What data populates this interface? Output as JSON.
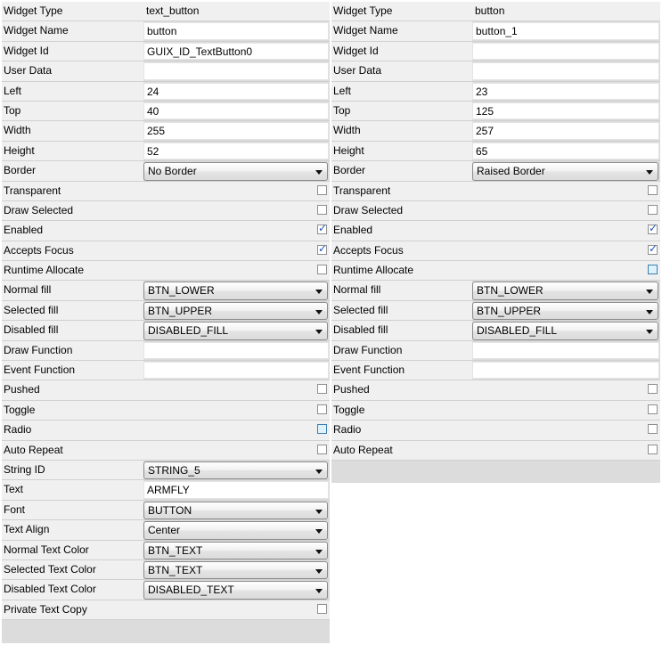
{
  "left_panel": {
    "rows": [
      {
        "label": "Widget Type",
        "kind": "readonly",
        "value": "text_button"
      },
      {
        "label": "Widget Name",
        "kind": "text",
        "value": "button"
      },
      {
        "label": "Widget Id",
        "kind": "text",
        "value": "GUIX_ID_TextButton0"
      },
      {
        "label": "User Data",
        "kind": "text",
        "value": ""
      },
      {
        "label": "Left",
        "kind": "text",
        "value": "24"
      },
      {
        "label": "Top",
        "kind": "text",
        "value": "40"
      },
      {
        "label": "Width",
        "kind": "text",
        "value": "255"
      },
      {
        "label": "Height",
        "kind": "text",
        "value": "52"
      },
      {
        "label": "Border",
        "kind": "dropdown",
        "value": "No Border"
      },
      {
        "label": "Transparent",
        "kind": "checkbox",
        "checked": false
      },
      {
        "label": "Draw Selected",
        "kind": "checkbox",
        "checked": false
      },
      {
        "label": "Enabled",
        "kind": "checkbox",
        "checked": true
      },
      {
        "label": "Accepts Focus",
        "kind": "checkbox",
        "checked": true
      },
      {
        "label": "Runtime Allocate",
        "kind": "checkbox",
        "checked": false
      },
      {
        "label": "Normal fill",
        "kind": "dropdown",
        "value": "BTN_LOWER"
      },
      {
        "label": "Selected fill",
        "kind": "dropdown",
        "value": "BTN_UPPER"
      },
      {
        "label": "Disabled fill",
        "kind": "dropdown",
        "value": "DISABLED_FILL"
      },
      {
        "label": "Draw Function",
        "kind": "text",
        "value": ""
      },
      {
        "label": "Event Function",
        "kind": "text",
        "value": ""
      },
      {
        "label": "Pushed",
        "kind": "checkbox",
        "checked": false
      },
      {
        "label": "Toggle",
        "kind": "checkbox",
        "checked": false
      },
      {
        "label": "Radio",
        "kind": "checkbox",
        "checked": false,
        "hot": true
      },
      {
        "label": "Auto Repeat",
        "kind": "checkbox",
        "checked": false
      },
      {
        "label": "String ID",
        "kind": "dropdown",
        "value": "STRING_5"
      },
      {
        "label": "Text",
        "kind": "text",
        "value": "ARMFLY"
      },
      {
        "label": "Font",
        "kind": "dropdown",
        "value": "BUTTON"
      },
      {
        "label": "Text Align",
        "kind": "dropdown",
        "value": "Center"
      },
      {
        "label": "Normal Text Color",
        "kind": "dropdown",
        "value": "BTN_TEXT"
      },
      {
        "label": "Selected Text Color",
        "kind": "dropdown",
        "value": "BTN_TEXT"
      },
      {
        "label": "Disabled Text Color",
        "kind": "dropdown",
        "value": "DISABLED_TEXT"
      },
      {
        "label": "Private Text Copy",
        "kind": "checkbox",
        "checked": false
      }
    ]
  },
  "right_panel": {
    "rows": [
      {
        "label": "Widget Type",
        "kind": "readonly",
        "value": "button"
      },
      {
        "label": "Widget Name",
        "kind": "text",
        "value": "button_1"
      },
      {
        "label": "Widget Id",
        "kind": "text",
        "value": ""
      },
      {
        "label": "User Data",
        "kind": "text",
        "value": ""
      },
      {
        "label": "Left",
        "kind": "text",
        "value": "23"
      },
      {
        "label": "Top",
        "kind": "text",
        "value": "125"
      },
      {
        "label": "Width",
        "kind": "text",
        "value": "257"
      },
      {
        "label": "Height",
        "kind": "text",
        "value": "65"
      },
      {
        "label": "Border",
        "kind": "dropdown",
        "value": "Raised Border"
      },
      {
        "label": "Transparent",
        "kind": "checkbox",
        "checked": false
      },
      {
        "label": "Draw Selected",
        "kind": "checkbox",
        "checked": false
      },
      {
        "label": "Enabled",
        "kind": "checkbox",
        "checked": true
      },
      {
        "label": "Accepts Focus",
        "kind": "checkbox",
        "checked": true
      },
      {
        "label": "Runtime Allocate",
        "kind": "checkbox",
        "checked": false,
        "hot": true
      },
      {
        "label": "Normal fill",
        "kind": "dropdown",
        "value": "BTN_LOWER"
      },
      {
        "label": "Selected fill",
        "kind": "dropdown",
        "value": "BTN_UPPER"
      },
      {
        "label": "Disabled fill",
        "kind": "dropdown",
        "value": "DISABLED_FILL"
      },
      {
        "label": "Draw Function",
        "kind": "text",
        "value": ""
      },
      {
        "label": "Event Function",
        "kind": "text",
        "value": ""
      },
      {
        "label": "Pushed",
        "kind": "checkbox",
        "checked": false
      },
      {
        "label": "Toggle",
        "kind": "checkbox",
        "checked": false
      },
      {
        "label": "Radio",
        "kind": "checkbox",
        "checked": false
      },
      {
        "label": "Auto Repeat",
        "kind": "checkbox",
        "checked": false
      }
    ]
  }
}
